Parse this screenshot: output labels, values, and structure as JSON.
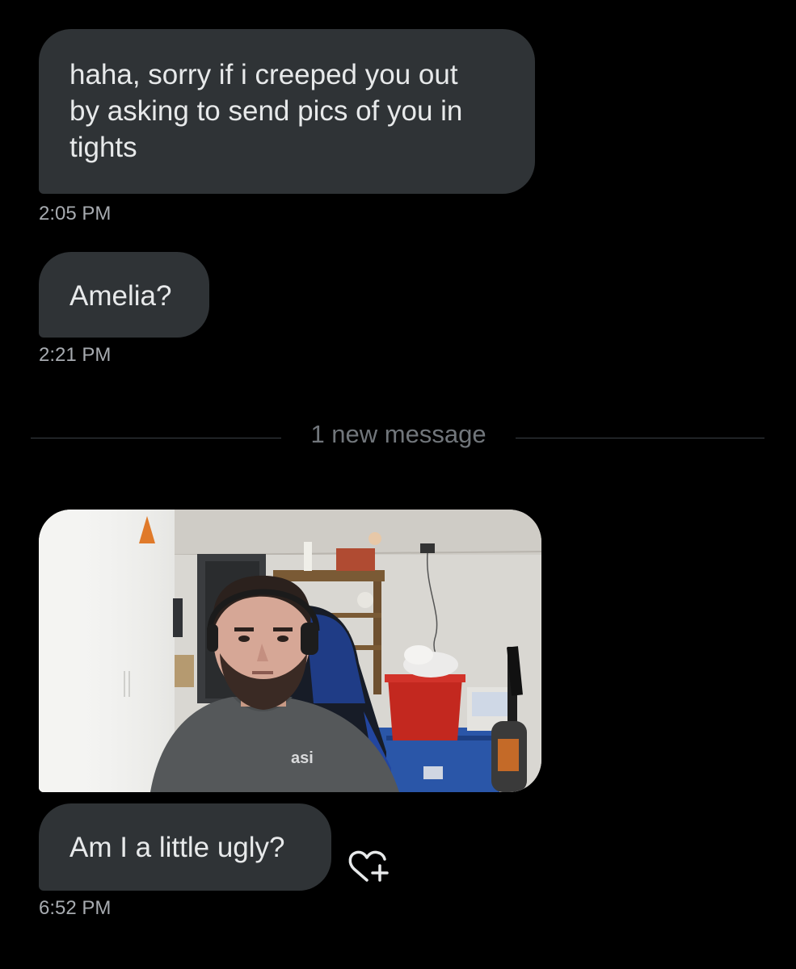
{
  "conversation": {
    "messages": [
      {
        "text": "haha, sorry if i creeped you out\nby asking to send pics of you in\ntights",
        "time": "2:05 PM"
      },
      {
        "text": "Amelia?",
        "time": "2:21 PM"
      }
    ],
    "new_messages_divider": "1 new message",
    "photo_message": {
      "image": "webcam-photo",
      "shirt_logo": "asi"
    },
    "last_message": {
      "text": "Am I a little ugly?",
      "time": "6:52 PM"
    }
  },
  "icons": {
    "reaction": "add-reaction-heart-icon"
  },
  "colors": {
    "background": "#000000",
    "bubble": "#2f3336",
    "text": "#e7e9ea",
    "timestamp": "#a7abb0",
    "divider": "#3b4046",
    "divider_text": "#71767b"
  }
}
